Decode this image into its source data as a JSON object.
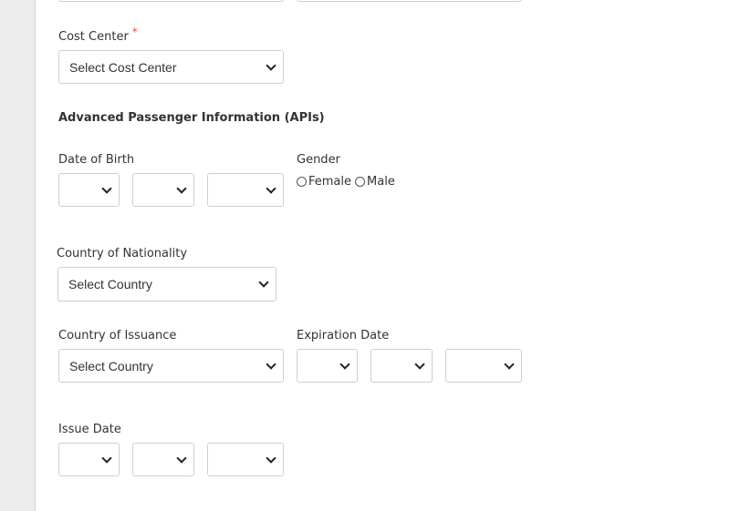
{
  "cost_center": {
    "label": "Cost Center",
    "required_mark": "*",
    "placeholder": "Select Cost Center"
  },
  "apis": {
    "heading": "Advanced Passenger Information (APIs)",
    "date_of_birth": {
      "label": "Date of Birth"
    },
    "gender": {
      "label": "Gender",
      "options": [
        "Female",
        "Male"
      ]
    },
    "nationality": {
      "label": "Country of Nationality",
      "placeholder": "Select Country"
    },
    "issuance": {
      "label": "Country of Issuance",
      "placeholder": "Select Country"
    },
    "expiration": {
      "label": "Expiration Date"
    },
    "issue_date": {
      "label": "Issue Date"
    }
  }
}
